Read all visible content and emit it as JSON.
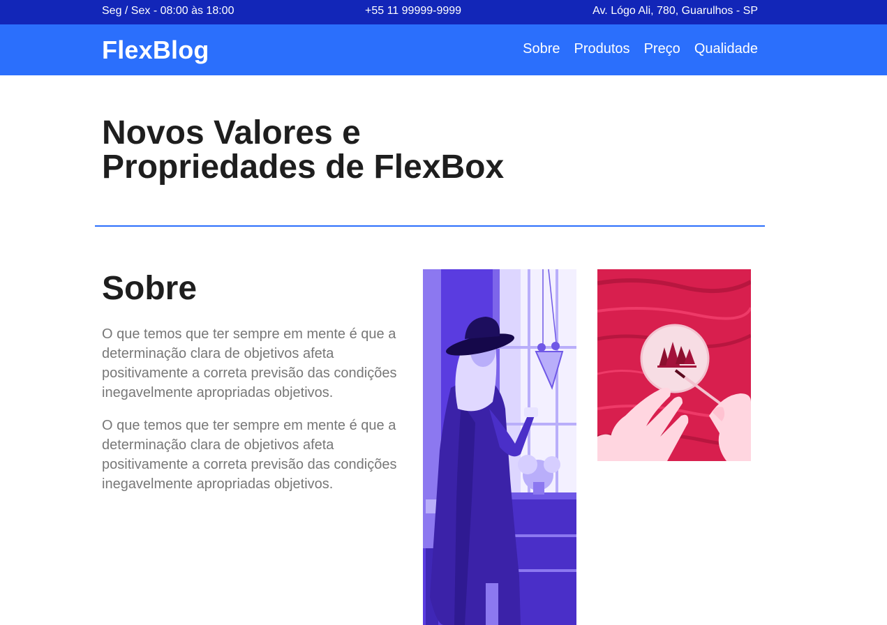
{
  "topbar": {
    "hours": "Seg / Sex - 08:00 às 18:00",
    "phone": "+55 11 99999-9999",
    "address": "Av. Lógo Ali, 780, Guarulhos - SP"
  },
  "header": {
    "logo": "FlexBlog",
    "nav": [
      "Sobre",
      "Produtos",
      "Preço",
      "Qualidade"
    ]
  },
  "hero": {
    "title": "Novos Valores e Propriedades de FlexBox"
  },
  "about": {
    "title": "Sobre",
    "paragraphs": [
      "O que temos que ter sempre em mente é que a determinação clara de objetivos afeta positivamente a correta previsão das condições inegavelmente apropriadas objetivos.",
      "O que temos que ter sempre em mente é que a determinação clara de objetivos afeta positivamente a correta previsão das condições inegavelmente apropriadas objetivos."
    ]
  },
  "colors": {
    "topbar": "#1226b8",
    "navbar": "#2b6ffc",
    "divider": "#2b6ffc",
    "body_text": "#777777",
    "heading": "#1e1e1e",
    "photo_purple_tint": "#5a3ce0",
    "photo_pink_tint": "#e8285a"
  }
}
